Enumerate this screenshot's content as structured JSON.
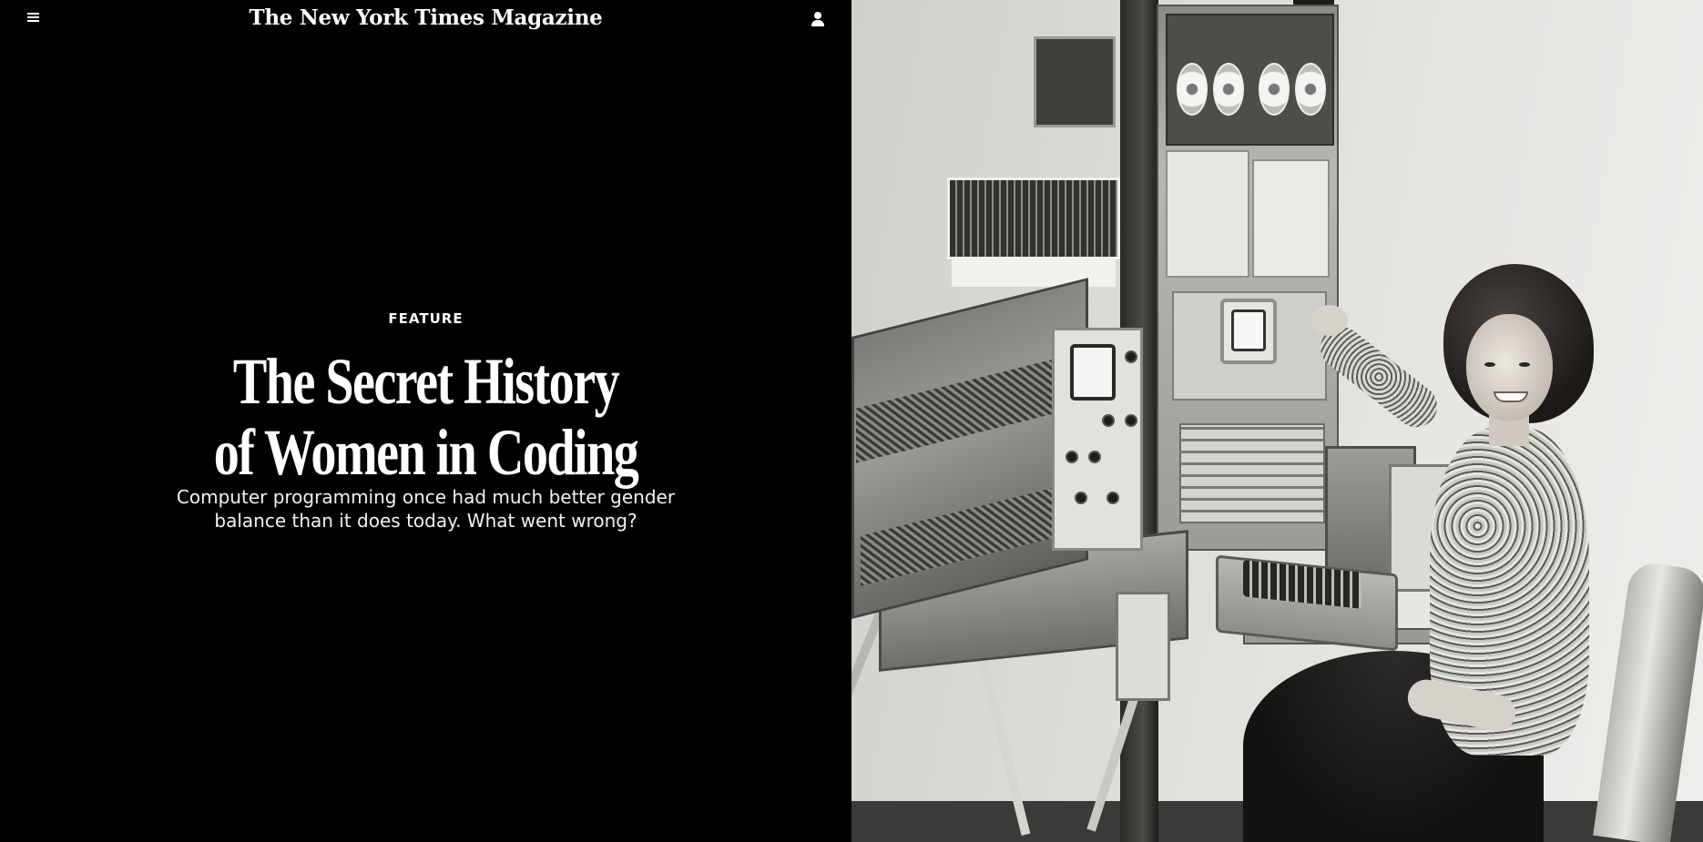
{
  "header": {
    "menu_icon": "hamburger-menu-icon",
    "masthead": "The New York Times Magazine",
    "account_icon": "user-account-icon"
  },
  "article": {
    "kicker": "FEATURE",
    "headline_line1": "The Secret History",
    "headline_line2": "of Women in Coding",
    "dek_line1": "Computer programming once had much better gender",
    "dek_line2": "balance than it does today. What went wrong?"
  },
  "colors": {
    "page_background": "#000000",
    "text": "#ffffff"
  }
}
